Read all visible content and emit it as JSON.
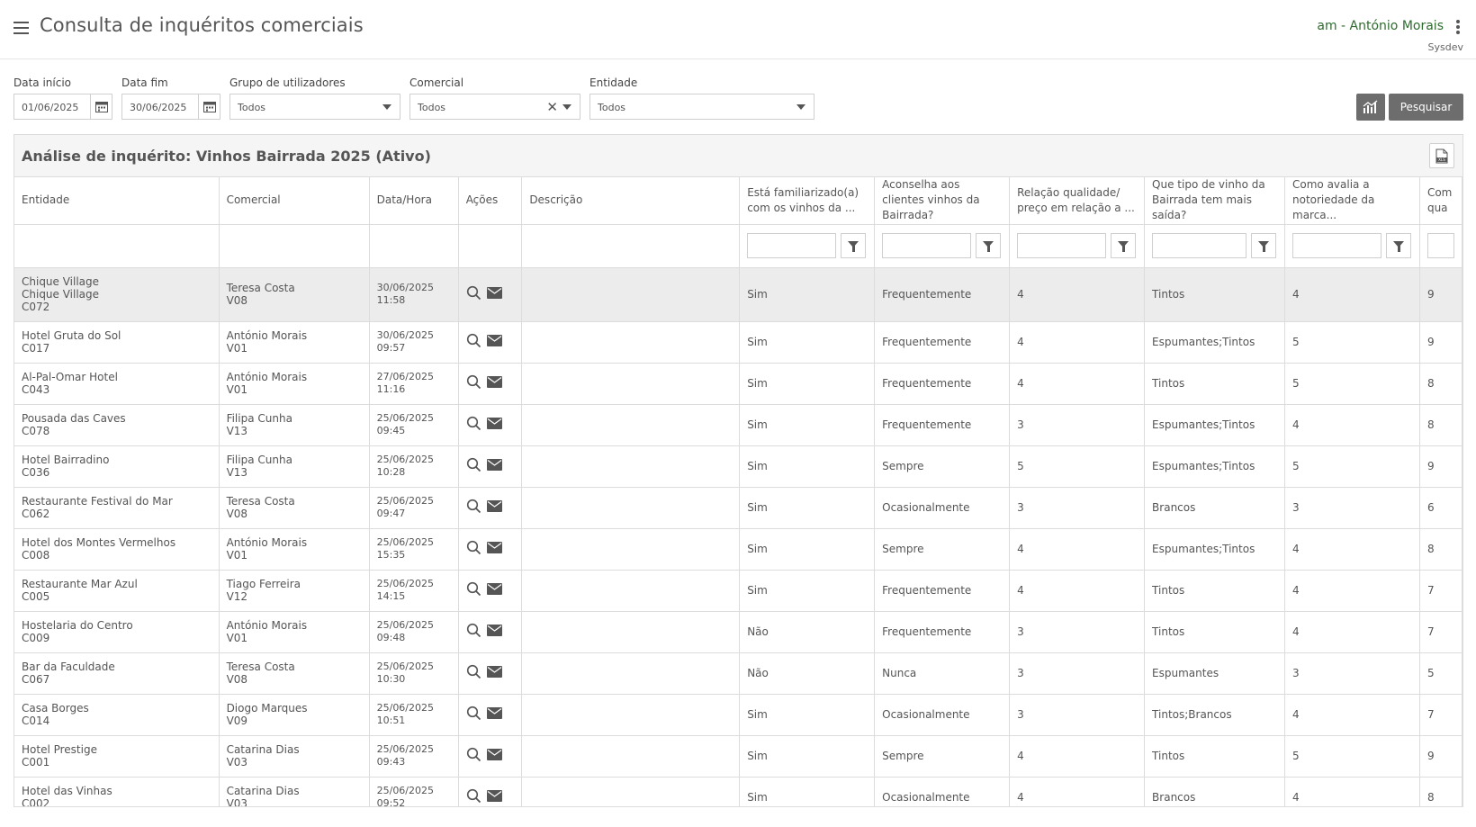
{
  "header": {
    "title": "Consulta de inquéritos comerciais",
    "user": "am - António Morais",
    "org": "Sysdev"
  },
  "filters": {
    "data_inicio_label": "Data início",
    "data_inicio_value": "01/06/2025",
    "data_fim_label": "Data fim",
    "data_fim_value": "30/06/2025",
    "grupo_label": "Grupo de utilizadores",
    "grupo_value": "Todos",
    "comercial_label": "Comercial",
    "comercial_value": "Todos",
    "entidade_label": "Entidade",
    "entidade_value": "Todos",
    "pesquisar_label": "Pesquisar"
  },
  "panel": {
    "title": "Análise de inquérito: Vinhos Bairrada 2025 (Ativo)"
  },
  "columns": [
    "Entidade",
    "Comercial",
    "Data/Hora",
    "Ações",
    "Descrição",
    "Está familiarizado(a) com os vinhos da ...",
    "Aconselha aos clientes vinhos da Bairrada?",
    "Relação qualidade/ preço em relação a ...",
    "Que tipo de vinho da Bairrada tem mais saída?",
    "Como avalia a notoriedade da marca...",
    "Com qua"
  ],
  "rows": [
    {
      "ent1": "Chique Village",
      "ent2": "Chique Village",
      "ent3": "C072",
      "com": "Teresa Costa",
      "com_code": "V08",
      "date": "30/06/2025",
      "time": "11:58",
      "desc": "",
      "q1": "Sim",
      "q2": "Frequentemente",
      "q3": "4",
      "q4": "Tintos",
      "q5": "4",
      "q6": "9"
    },
    {
      "ent1": "Hotel Gruta do Sol",
      "ent2": "C017",
      "com": "António Morais",
      "com_code": "V01",
      "date": "30/06/2025",
      "time": "09:57",
      "desc": "",
      "q1": "Sim",
      "q2": "Frequentemente",
      "q3": "4",
      "q4": "Espumantes;Tintos",
      "q5": "5",
      "q6": "9"
    },
    {
      "ent1": "Al-Pal-Omar Hotel",
      "ent2": "C043",
      "com": "António Morais",
      "com_code": "V01",
      "date": "27/06/2025",
      "time": "11:16",
      "desc": "",
      "q1": "Sim",
      "q2": "Frequentemente",
      "q3": "4",
      "q4": "Tintos",
      "q5": "5",
      "q6": "8"
    },
    {
      "ent1": "Pousada das Caves",
      "ent2": "C078",
      "com": "Filipa Cunha",
      "com_code": "V13",
      "date": "25/06/2025",
      "time": "09:45",
      "desc": "",
      "q1": "Sim",
      "q2": "Frequentemente",
      "q3": "3",
      "q4": "Espumantes;Tintos",
      "q5": "4",
      "q6": "8"
    },
    {
      "ent1": "Hotel Bairradino",
      "ent2": "C036",
      "com": "Filipa Cunha",
      "com_code": "V13",
      "date": "25/06/2025",
      "time": "10:28",
      "desc": "",
      "q1": "Sim",
      "q2": "Sempre",
      "q3": "5",
      "q4": "Espumantes;Tintos",
      "q5": "5",
      "q6": "9"
    },
    {
      "ent1": "Restaurante Festival do Mar",
      "ent2": "C062",
      "com": "Teresa Costa",
      "com_code": "V08",
      "date": "25/06/2025",
      "time": "09:47",
      "desc": "",
      "q1": "Sim",
      "q2": "Ocasionalmente",
      "q3": "3",
      "q4": "Brancos",
      "q5": "3",
      "q6": "6"
    },
    {
      "ent1": "Hotel dos Montes Vermelhos",
      "ent2": "C008",
      "com": "António Morais",
      "com_code": "V01",
      "date": "25/06/2025",
      "time": "15:35",
      "desc": "",
      "q1": "Sim",
      "q2": "Sempre",
      "q3": "4",
      "q4": "Espumantes;Tintos",
      "q5": "4",
      "q6": "8"
    },
    {
      "ent1": "Restaurante Mar Azul",
      "ent2": "C005",
      "com": "Tiago Ferreira",
      "com_code": "V12",
      "date": "25/06/2025",
      "time": "14:15",
      "desc": "",
      "q1": "Sim",
      "q2": "Frequentemente",
      "q3": "4",
      "q4": "Tintos",
      "q5": "4",
      "q6": "7"
    },
    {
      "ent1": "Hostelaria do Centro",
      "ent2": "C009",
      "com": "António Morais",
      "com_code": "V01",
      "date": "25/06/2025",
      "time": "09:48",
      "desc": "",
      "q1": "Não",
      "q2": "Frequentemente",
      "q3": "3",
      "q4": "Tintos",
      "q5": "4",
      "q6": "7"
    },
    {
      "ent1": "Bar da Faculdade",
      "ent2": "C067",
      "com": "Teresa Costa",
      "com_code": "V08",
      "date": "25/06/2025",
      "time": "10:30",
      "desc": "",
      "q1": "Não",
      "q2": "Nunca",
      "q3": "3",
      "q4": "Espumantes",
      "q5": "3",
      "q6": "5"
    },
    {
      "ent1": "Casa Borges",
      "ent2": "C014",
      "com": "Diogo Marques",
      "com_code": "V09",
      "date": "25/06/2025",
      "time": "10:51",
      "desc": "",
      "q1": "Sim",
      "q2": "Ocasionalmente",
      "q3": "3",
      "q4": "Tintos;Brancos",
      "q5": "4",
      "q6": "7"
    },
    {
      "ent1": "Hotel Prestige",
      "ent2": "C001",
      "com": "Catarina Dias",
      "com_code": "V03",
      "date": "25/06/2025",
      "time": "09:43",
      "desc": "",
      "q1": "Sim",
      "q2": "Sempre",
      "q3": "4",
      "q4": "Tintos",
      "q5": "5",
      "q6": "9"
    },
    {
      "ent1": "Hotel das Vinhas",
      "ent2": "C002",
      "com": "Catarina Dias",
      "com_code": "V03",
      "date": "25/06/2025",
      "time": "09:52",
      "desc": "",
      "q1": "Sim",
      "q2": "Ocasionalmente",
      "q3": "4",
      "q4": "Brancos",
      "q5": "4",
      "q6": "8"
    }
  ]
}
